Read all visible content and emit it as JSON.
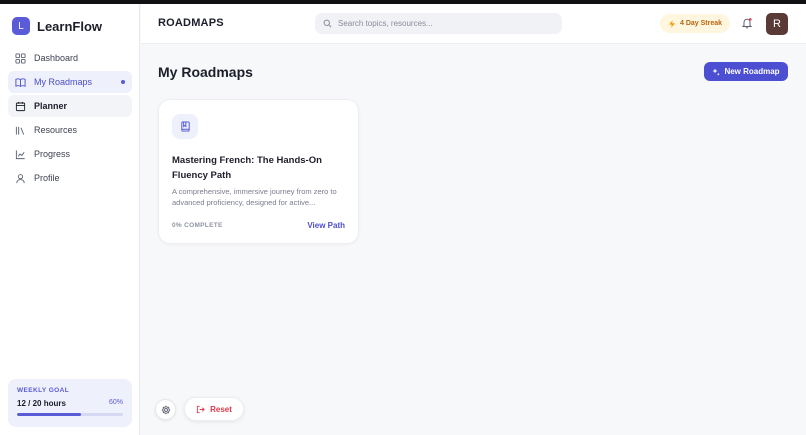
{
  "brand": {
    "logo_letter": "L",
    "name": "LearnFlow"
  },
  "sidebar": {
    "items": [
      {
        "label": "Dashboard",
        "icon": "grid-icon"
      },
      {
        "label": "My Roadmaps",
        "icon": "book-open-icon",
        "state": "active"
      },
      {
        "label": "Planner",
        "icon": "calendar-icon",
        "state": "hover"
      },
      {
        "label": "Resources",
        "icon": "library-icon"
      },
      {
        "label": "Progress",
        "icon": "chart-line-icon"
      },
      {
        "label": "Profile",
        "icon": "user-icon"
      }
    ],
    "weekly_goal": {
      "title": "WEEKLY GOAL",
      "hours": "12 / 20 hours",
      "percent_label": "60%",
      "progress": 0.6
    }
  },
  "header": {
    "title": "ROADMAPS",
    "search_placeholder": "Search topics, resources...",
    "streak": "4 Day Streak",
    "avatar_letter": "R"
  },
  "main": {
    "title": "My Roadmaps",
    "new_button": "New Roadmap",
    "cards": [
      {
        "icon": "book-icon",
        "title": "Mastering French: The Hands-On Fluency Path",
        "description": "A comprehensive, immersive journey from zero to advanced proficiency, designed for active...",
        "progress": "0% COMPLETE",
        "link": "View Path"
      }
    ]
  },
  "controls": {
    "reset": "Reset"
  },
  "colors": {
    "accent": "#4c4fd1",
    "streak": "#b9650d",
    "reset": "#e0394b",
    "avatar": "#5a3a36"
  }
}
